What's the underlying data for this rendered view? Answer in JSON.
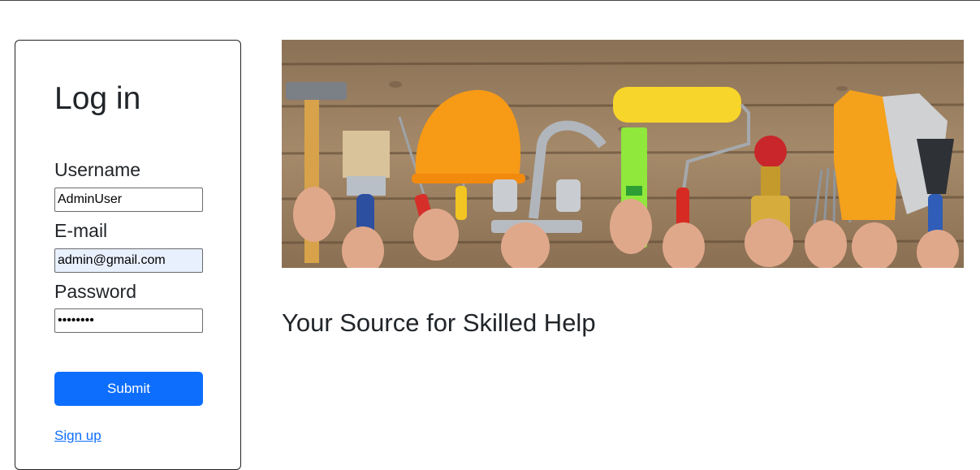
{
  "login": {
    "title": "Log in",
    "username_label": "Username",
    "username_value": "AdminUser",
    "email_label": "E-mail",
    "email_value": "admin@gmail.com",
    "password_label": "Password",
    "password_value": "password",
    "submit_label": "Submit",
    "signup_label": "Sign up"
  },
  "hero": {
    "tagline": "Your Source for Skilled Help"
  },
  "colors": {
    "primary": "#0d6efd",
    "autofill": "#e8f0fe",
    "text": "#212529"
  }
}
